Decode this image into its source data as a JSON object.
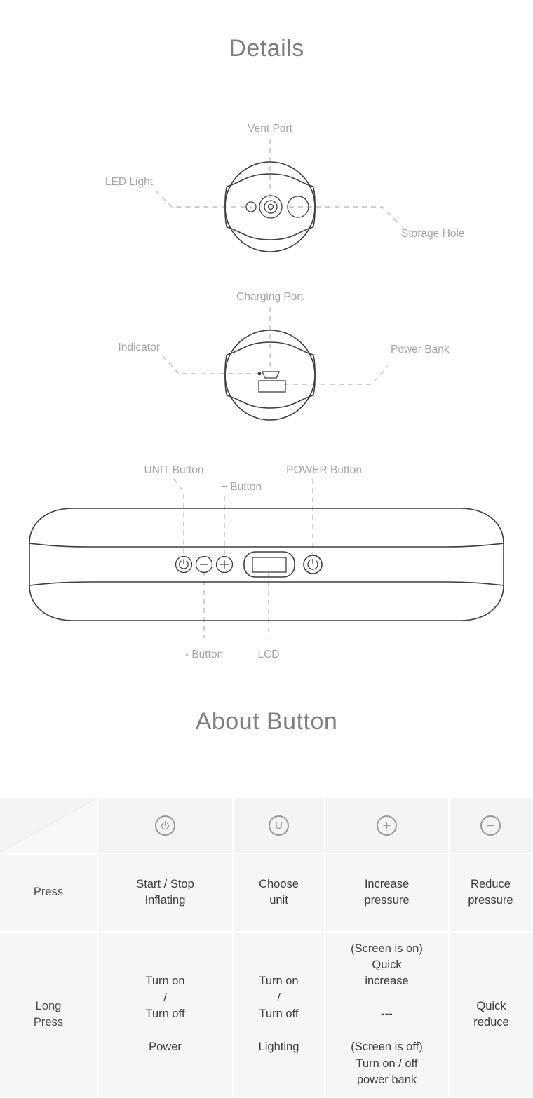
{
  "headings": {
    "details": "Details",
    "about_button": "About Button"
  },
  "diagrams": [
    {
      "name": "vent-port-view",
      "labels": {
        "top": "Vent Port",
        "left": "LED Light",
        "right": "Storage Hole"
      }
    },
    {
      "name": "charging-port-view",
      "labels": {
        "top": "Charging Port",
        "left": "Indicator",
        "right": "Power Bank"
      }
    },
    {
      "name": "button-panel-view",
      "labels": {
        "unit_button": "UNIT Button",
        "plus_button": "+ Button",
        "power_button": "POWER Button",
        "minus_button": "- Button",
        "lcd": "LCD"
      }
    }
  ],
  "table": {
    "corner_label": "",
    "columns": [
      {
        "icon": "power-icon",
        "glyph": "power"
      },
      {
        "icon": "unit-icon",
        "glyph": "U"
      },
      {
        "icon": "plus-icon",
        "glyph": "+"
      },
      {
        "icon": "minus-icon",
        "glyph": "−"
      }
    ],
    "rows": [
      {
        "label": "Press",
        "cells": [
          "Start / Stop\nInflating",
          "Choose\nunit",
          "Increase\npressure",
          "Reduce\npressure"
        ]
      },
      {
        "label": "Long\nPress",
        "cells": [
          "Turn on\n/\nTurn off\n\nPower",
          "Turn on\n/\nTurn off\n\nLighting",
          "(Screen is on)\nQuick\nincrease\n\n---\n\n(Screen is off)\nTurn on / off\npower bank",
          "Quick\nreduce"
        ]
      }
    ]
  },
  "colors": {
    "heading": "#7d7d7d",
    "label": "#a3a3a3",
    "outline": "#3e3e3e",
    "leader": "#bdbdbd",
    "cell_bg": "#f6f6f6",
    "cell_text": "#3c3c3c"
  }
}
